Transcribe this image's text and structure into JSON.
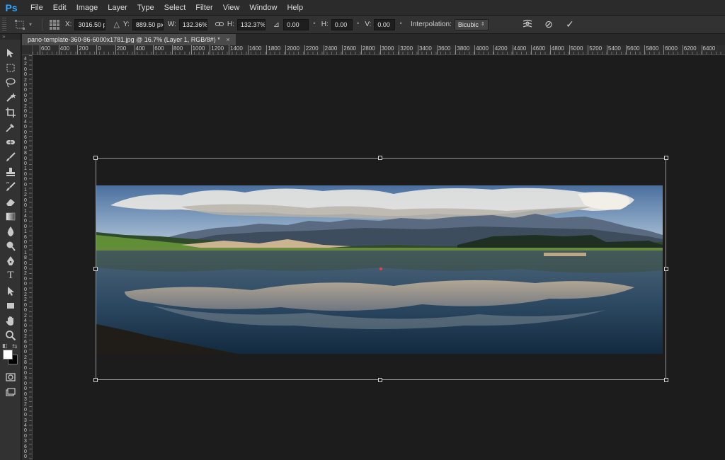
{
  "app": {
    "logo": "Ps"
  },
  "menu": [
    "File",
    "Edit",
    "Image",
    "Layer",
    "Type",
    "Select",
    "Filter",
    "View",
    "Window",
    "Help"
  ],
  "options": {
    "x_label": "X:",
    "x_value": "3016.50 p",
    "y_label": "Y:",
    "y_value": "889.50 px",
    "w_label": "W:",
    "w_value": "132.36%",
    "h_label": "H:",
    "h_value": "132.37%",
    "angle_value": "0.00",
    "angle_unit": "°",
    "hskew_label": "H:",
    "hskew_value": "0.00",
    "hskew_unit": "°",
    "vskew_label": "V:",
    "vskew_value": "0.00",
    "vskew_unit": "°",
    "interp_label": "Interpolation:",
    "interp_value": "Bicubic"
  },
  "document_tab": {
    "title": "pano-template-360-86-6000x1781.jpg @ 16.7% (Layer 1, RGB/8#) *",
    "close": "×"
  },
  "ruler_h": [
    "600",
    "400",
    "200",
    "0",
    "200",
    "400",
    "600",
    "800",
    "1000",
    "1200",
    "1400",
    "1600",
    "1800",
    "2000",
    "2200",
    "2400",
    "2600",
    "2800",
    "3000",
    "3200",
    "3400",
    "3600",
    "3800",
    "4000",
    "4200",
    "4400",
    "4600",
    "4800",
    "5000",
    "5200",
    "5400",
    "5600",
    "5800",
    "6000",
    "6200",
    "6400"
  ],
  "ruler_v": [
    "4",
    "2",
    "0",
    "0",
    "2",
    "0",
    "0",
    "0",
    "0",
    "2",
    "0",
    "0",
    "4",
    "0",
    "0",
    "6",
    "0",
    "0",
    "8",
    "0",
    "0",
    "1",
    "0",
    "0",
    "0",
    "1",
    "2",
    "0",
    "0",
    "1",
    "4",
    "0",
    "0",
    "1",
    "6",
    "0",
    "0",
    "1",
    "8",
    "0",
    "0",
    "2",
    "0",
    "0",
    "0",
    "2",
    "2",
    "0",
    "0",
    "2",
    "4",
    "0",
    "0",
    "2",
    "6",
    "0",
    "0",
    "2",
    "8",
    "0",
    "0",
    "3",
    "0",
    "0",
    "0",
    "3",
    "2",
    "0",
    "0",
    "3",
    "4",
    "0",
    "0",
    "3",
    "6",
    "0",
    "0",
    "3",
    "8"
  ],
  "colors": {
    "foreground": "#ffffff",
    "background": "#000000",
    "accent": "#31a8ff"
  },
  "icons": {
    "commit": "✓",
    "cancel": "⊘",
    "warp": "warp-icon",
    "link": "link-icon"
  }
}
